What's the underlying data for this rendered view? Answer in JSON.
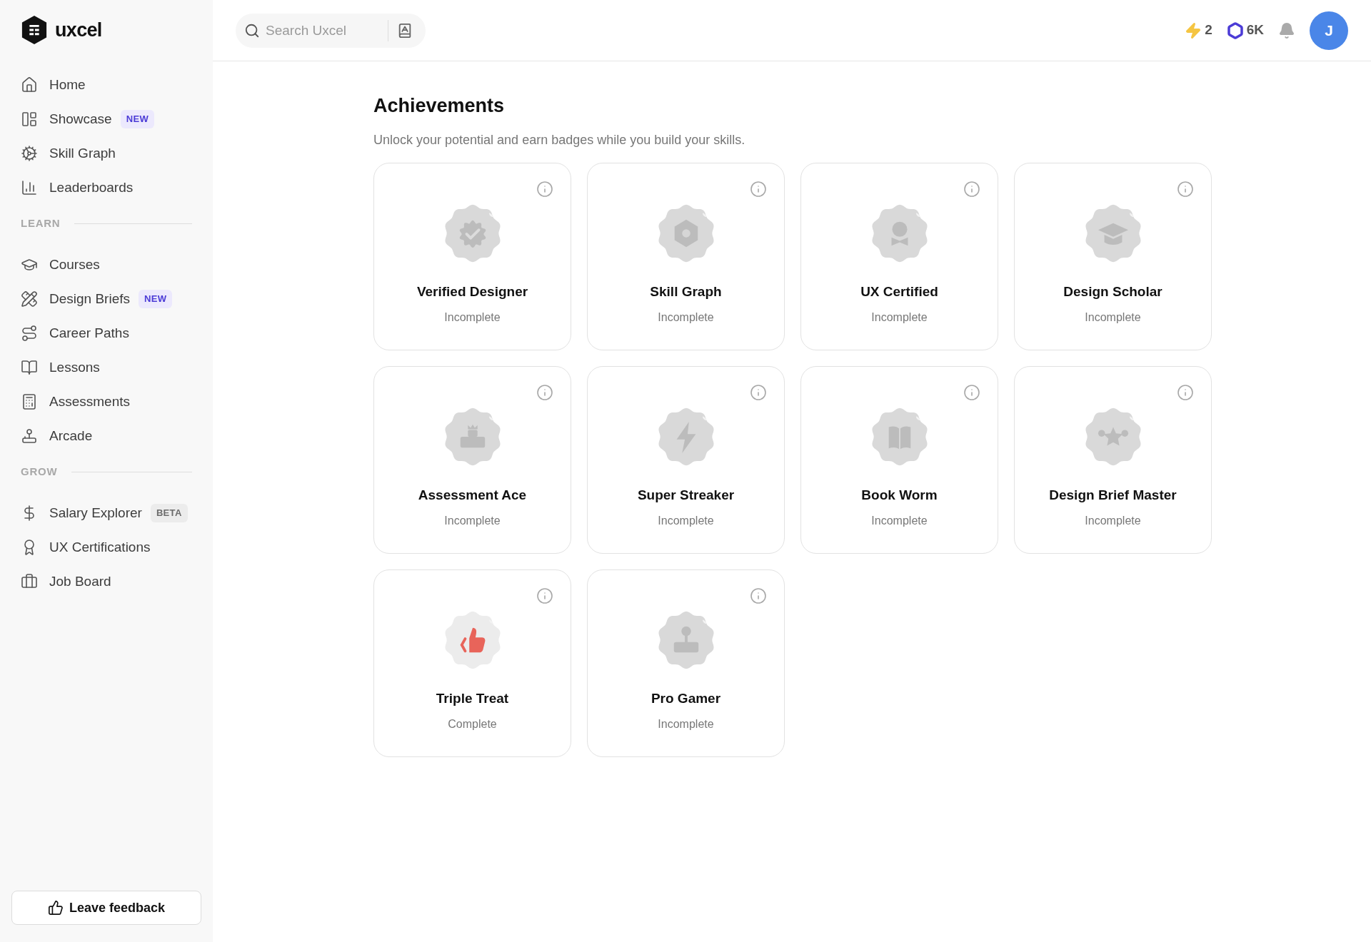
{
  "sidebar": {
    "logo": "uxcel",
    "main_items": [
      {
        "label": "Home"
      },
      {
        "label": "Showcase",
        "tag": {
          "text": "NEW",
          "kind": "new"
        }
      },
      {
        "label": "Skill Graph"
      },
      {
        "label": "Leaderboards"
      }
    ],
    "sections": [
      {
        "title": "LEARN",
        "items": [
          {
            "label": "Courses"
          },
          {
            "label": "Design Briefs",
            "tag": {
              "text": "NEW",
              "kind": "new"
            }
          },
          {
            "label": "Career Paths"
          },
          {
            "label": "Lessons"
          },
          {
            "label": "Assessments"
          },
          {
            "label": "Arcade"
          }
        ]
      },
      {
        "title": "GROW",
        "items": [
          {
            "label": "Salary Explorer",
            "tag": {
              "text": "BETA",
              "kind": "beta"
            }
          },
          {
            "label": "UX Certifications"
          },
          {
            "label": "Job Board"
          }
        ]
      }
    ],
    "feedback_button": "Leave feedback"
  },
  "topbar": {
    "search": {
      "placeholder": "Search Uxcel"
    },
    "streak": "2",
    "gems": "6K",
    "avatar": "J"
  },
  "page": {
    "title": "Achievements",
    "subtitle": "Unlock your potential and earn badges while you build your skills.",
    "achievements": [
      {
        "name": "Verified Designer",
        "status": "Incomplete",
        "complete": false,
        "kind": "check"
      },
      {
        "name": "Skill Graph",
        "status": "Incomplete",
        "complete": false,
        "kind": "gear"
      },
      {
        "name": "UX Certified",
        "status": "Incomplete",
        "complete": false,
        "kind": "bowtie"
      },
      {
        "name": "Design Scholar",
        "status": "Incomplete",
        "complete": false,
        "kind": "cap"
      },
      {
        "name": "Assessment Ace",
        "status": "Incomplete",
        "complete": false,
        "kind": "podium"
      },
      {
        "name": "Super Streaker",
        "status": "Incomplete",
        "complete": false,
        "kind": "bolt"
      },
      {
        "name": "Book Worm",
        "status": "Incomplete",
        "complete": false,
        "kind": "book"
      },
      {
        "name": "Design Brief Master",
        "status": "Incomplete",
        "complete": false,
        "kind": "stars"
      },
      {
        "name": "Triple Treat",
        "status": "Complete",
        "complete": true,
        "kind": "thumb"
      },
      {
        "name": "Pro Gamer",
        "status": "Incomplete",
        "complete": false,
        "kind": "joystick"
      }
    ]
  }
}
